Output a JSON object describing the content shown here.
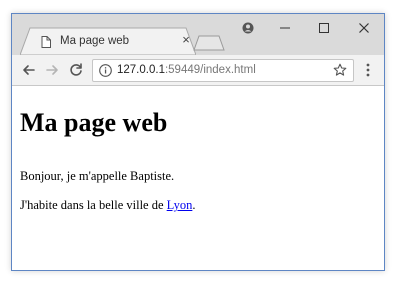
{
  "browser": {
    "tab": {
      "title": "Ma page web",
      "close_glyph": "×"
    },
    "address_bar": {
      "host": "127.0.0.1",
      "port_path": ":59449/index.html"
    },
    "icons": {
      "favicon": "page-icon",
      "back": "arrow-left-icon",
      "forward": "arrow-right-icon",
      "reload": "reload-icon",
      "info": "info-icon",
      "bookmark": "star-icon",
      "menu": "more-vert-icon",
      "profile": "profile-icon",
      "minimize": "minimize-icon",
      "maximize": "maximize-icon",
      "close_window": "close-icon"
    },
    "colors": {
      "frame": "#dadada",
      "toolbar": "#f2f2f2",
      "border": "#5e86c4",
      "link": "#0000ee"
    }
  },
  "page": {
    "heading": "Ma page web",
    "paragraph1": "Bonjour, je m'appelle Baptiste.",
    "paragraph2_before": "J'habite dans la belle ville de ",
    "paragraph2_link": "Lyon",
    "paragraph2_after": "."
  }
}
